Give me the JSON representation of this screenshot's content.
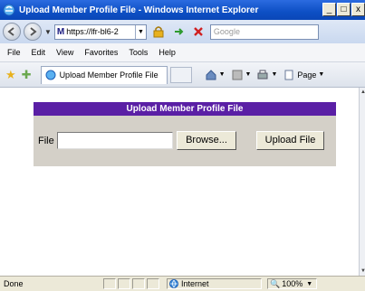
{
  "window": {
    "title": "Upload Member Profile File - Windows Internet Explorer",
    "minimize_glyph": "_",
    "maximize_glyph": "□",
    "close_glyph": "x"
  },
  "address_bar": {
    "url": "https://lfr-bl6-2",
    "search_placeholder": "Google",
    "icons": [
      "back-icon",
      "forward-icon",
      "lock-icon",
      "refresh-icon",
      "stop-icon"
    ]
  },
  "menu": {
    "items": [
      "File",
      "Edit",
      "View",
      "Favorites",
      "Tools",
      "Help"
    ]
  },
  "tab_bar": {
    "tab_label": "Upload Member Profile File",
    "page_label": "Page"
  },
  "form": {
    "header": "Upload Member Profile File",
    "file_label": "File",
    "file_value": "",
    "browse_label": "Browse...",
    "upload_label": "Upload File"
  },
  "status_bar": {
    "status": "Done",
    "zone": "Internet",
    "zoom": "100%"
  },
  "colors": {
    "header_bg": "#5a1fa5",
    "panel_bg": "#d4d0c8",
    "titlebar_bg": "#0d4fc4"
  }
}
